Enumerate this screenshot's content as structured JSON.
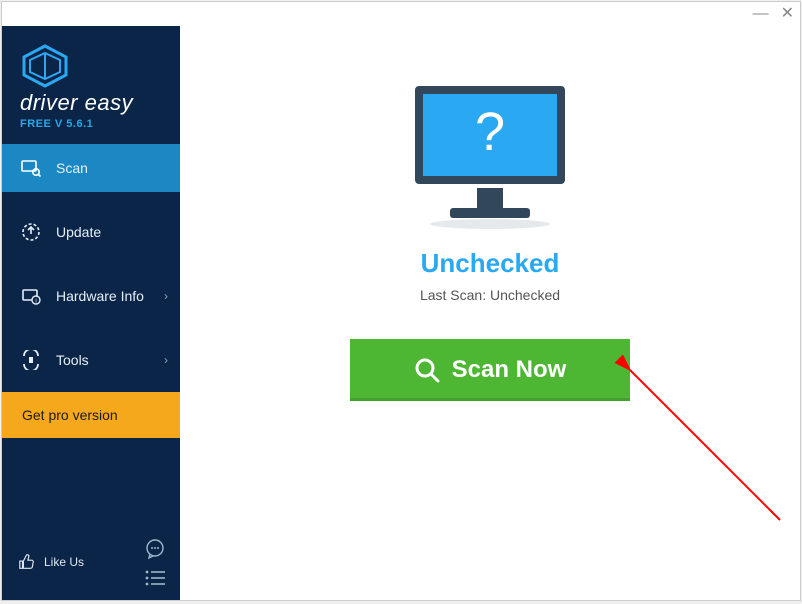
{
  "titlebar": {
    "min": "—",
    "close": "✕"
  },
  "brand": {
    "name": "driver easy",
    "version": "FREE V 5.6.1"
  },
  "sidebar": {
    "items": [
      {
        "label": "Scan"
      },
      {
        "label": "Update"
      },
      {
        "label": "Hardware Info"
      },
      {
        "label": "Tools"
      }
    ],
    "pro_label": "Get pro version",
    "likeus": "Like Us"
  },
  "main": {
    "status_title": "Unchecked",
    "status_sub": "Last Scan: Unchecked",
    "scan_label": "Scan Now"
  }
}
